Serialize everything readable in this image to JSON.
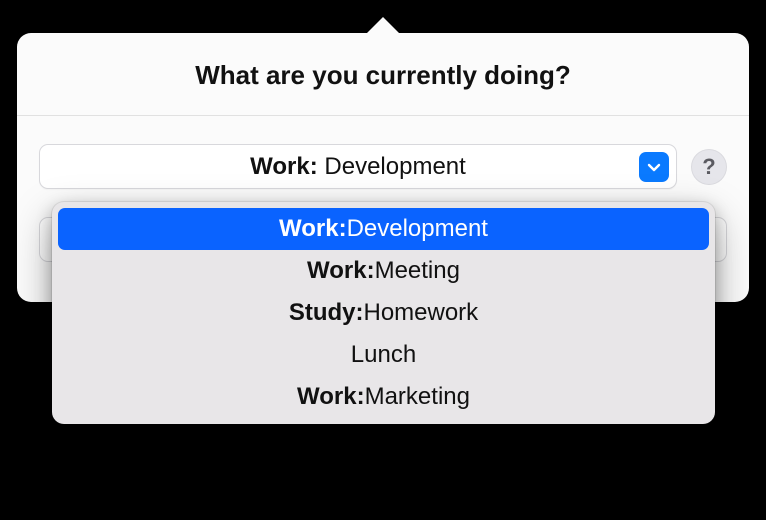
{
  "header": {
    "title": "What are you currently doing?"
  },
  "select": {
    "selected": {
      "category": "Work:",
      "label": " Development"
    },
    "help_symbol": "?"
  },
  "menu": {
    "items": [
      {
        "category": "Work:",
        "label": " Development",
        "selected": true
      },
      {
        "category": "Work:",
        "label": " Meeting",
        "selected": false
      },
      {
        "category": "Study:",
        "label": " Homework",
        "selected": false
      },
      {
        "category": "",
        "label": "Lunch",
        "selected": false
      },
      {
        "category": "Work:",
        "label": " Marketing",
        "selected": false
      }
    ]
  },
  "colors": {
    "accent": "#0a63ff",
    "disclosure": "#0a7aff"
  }
}
